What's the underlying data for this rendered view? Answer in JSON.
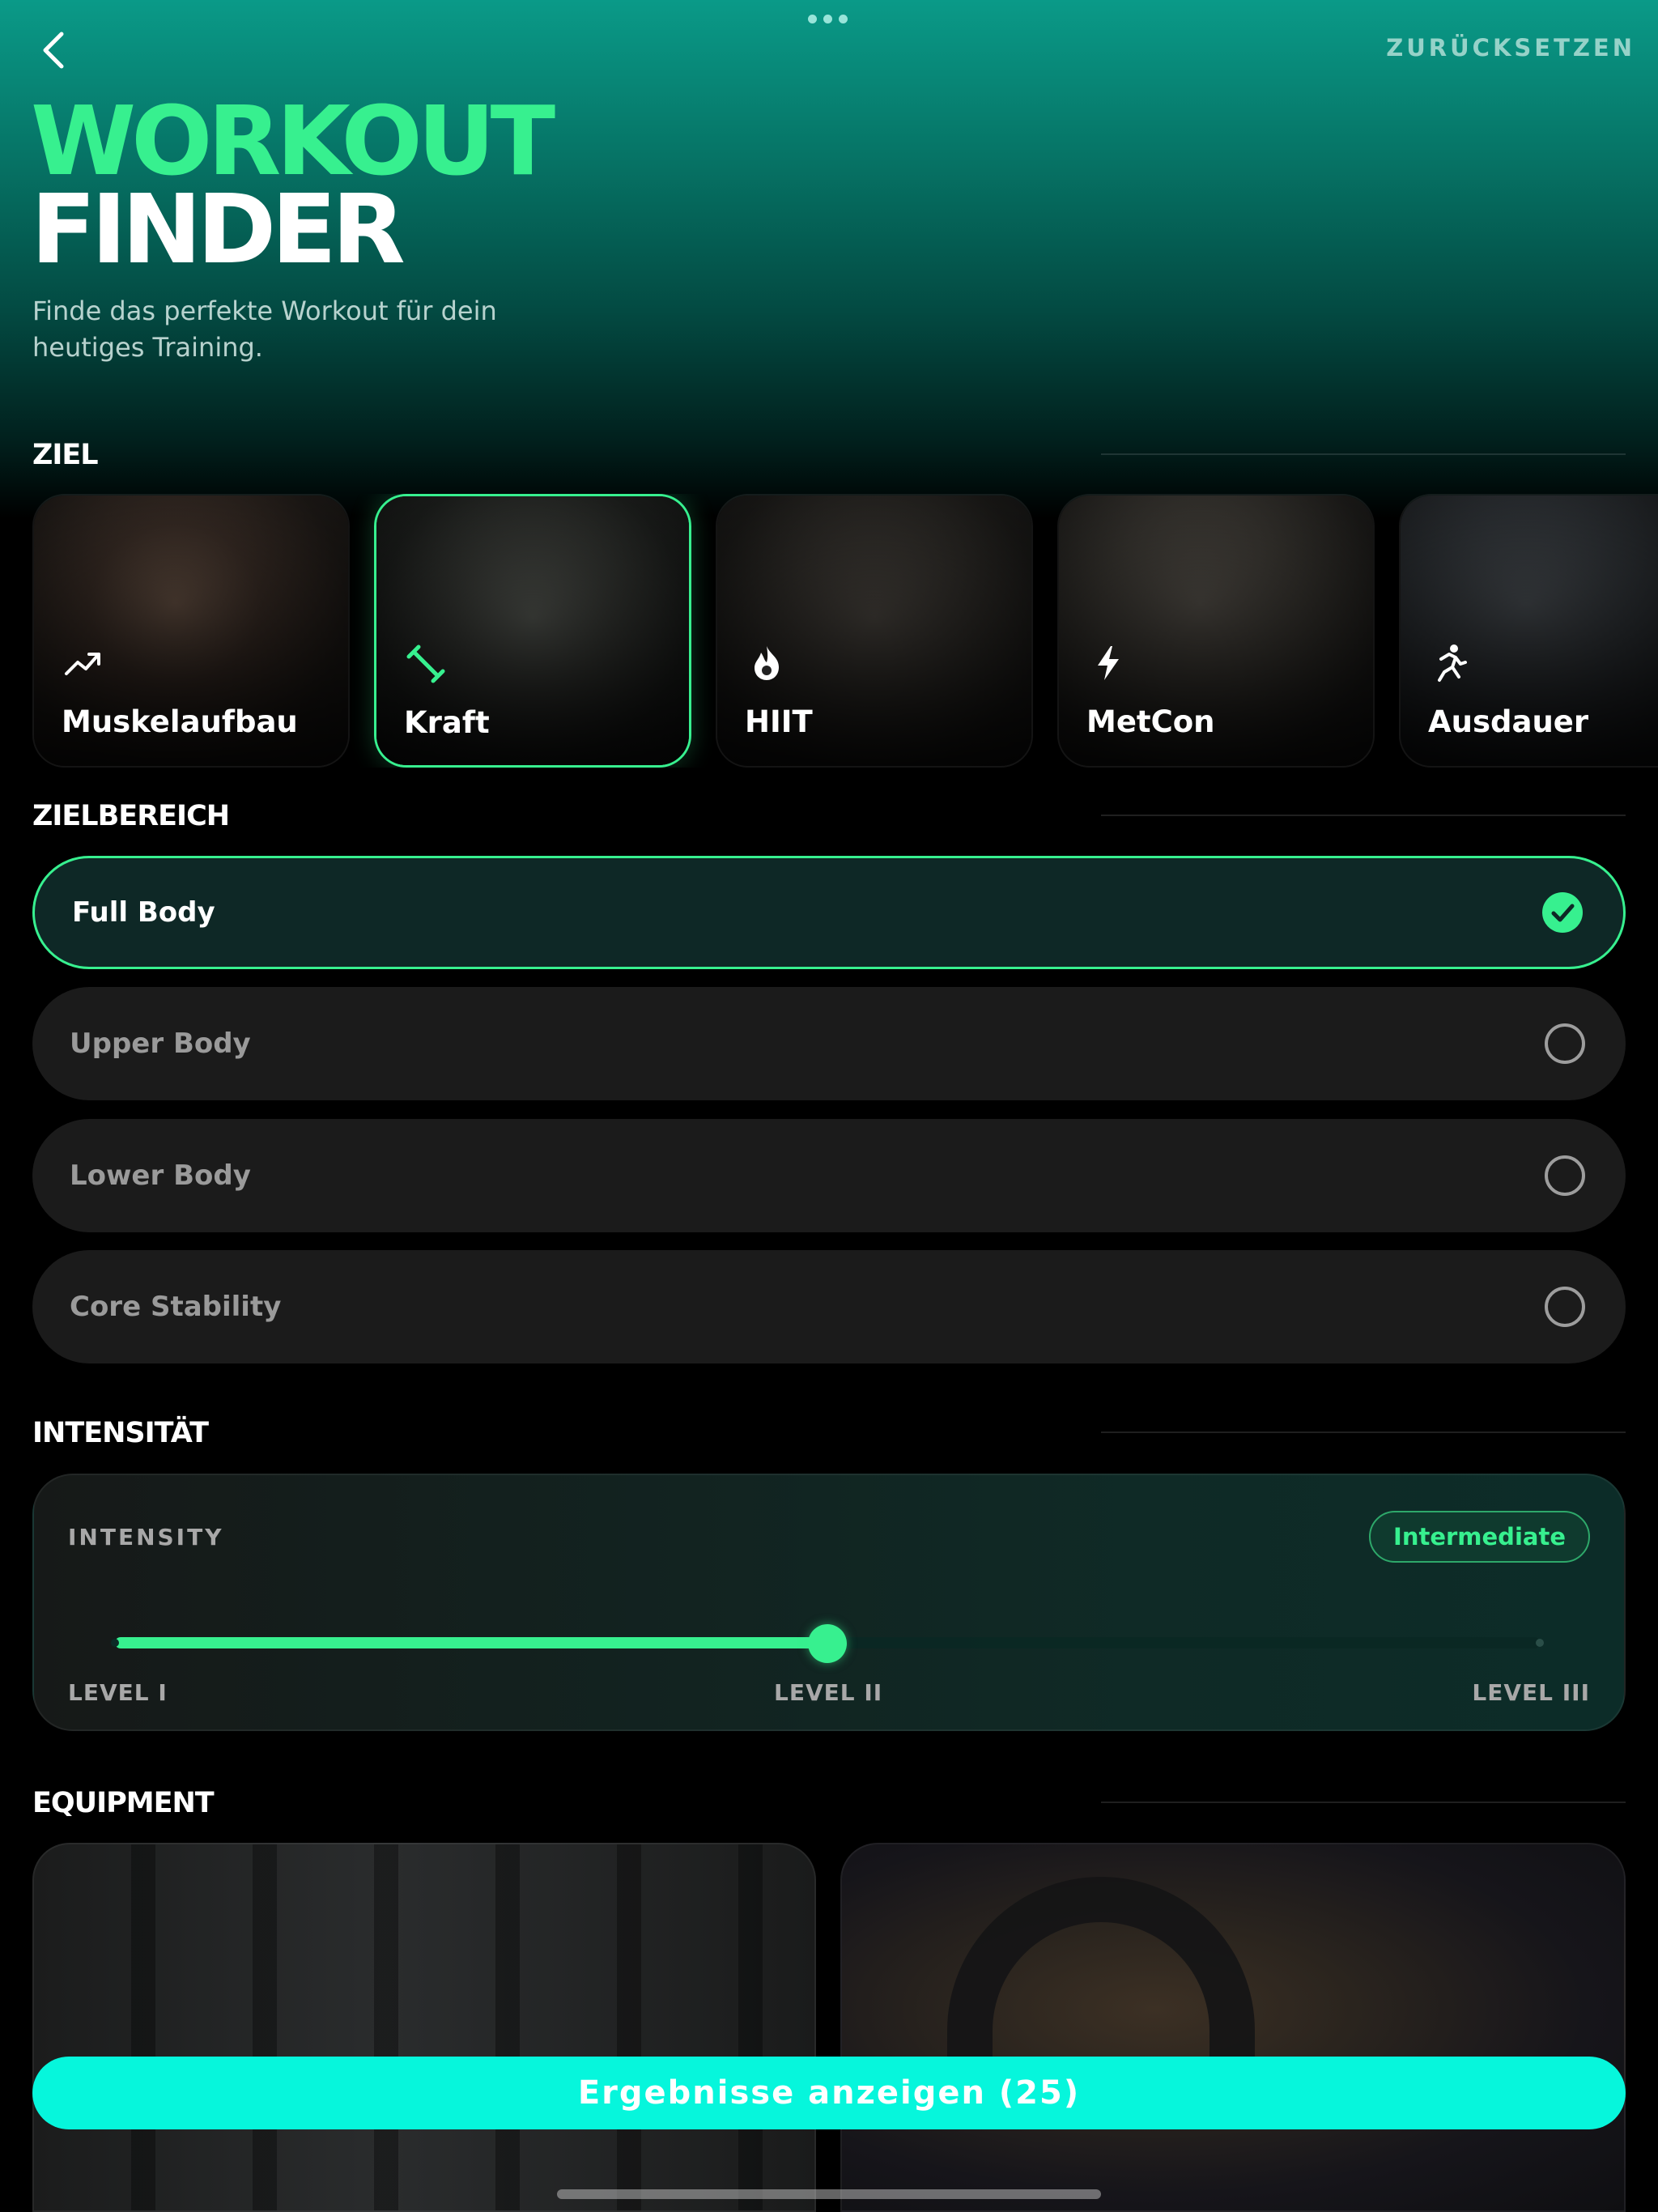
{
  "nav": {
    "reset_label": "ZURÜCKSETZEN"
  },
  "header": {
    "title_line1": "WORKOUT",
    "title_line2": "FINDER",
    "subtitle": "Finde das perfekte Workout für dein heutiges Training."
  },
  "goal": {
    "section_title": "ZIEL",
    "items": [
      {
        "label": "Muskelaufbau",
        "icon": "trending-up-icon",
        "selected": false
      },
      {
        "label": "Kraft",
        "icon": "dumbbell-icon",
        "selected": true
      },
      {
        "label": "HIIT",
        "icon": "flame-icon",
        "selected": false
      },
      {
        "label": "MetCon",
        "icon": "bolt-icon",
        "selected": false
      },
      {
        "label": "Ausdauer",
        "icon": "runner-icon",
        "selected": false
      }
    ]
  },
  "target_area": {
    "section_title": "ZIELBEREICH",
    "items": [
      {
        "label": "Full Body",
        "selected": true
      },
      {
        "label": "Upper Body",
        "selected": false
      },
      {
        "label": "Lower Body",
        "selected": false
      },
      {
        "label": "Core Stability",
        "selected": false
      }
    ]
  },
  "intensity": {
    "section_title": "INTENSITÄT",
    "card_label": "INTENSITY",
    "badge": "Intermediate",
    "value_fraction": 0.5,
    "levels": [
      "LEVEL I",
      "LEVEL II",
      "LEVEL III"
    ]
  },
  "equipment": {
    "section_title": "EQUIPMENT"
  },
  "cta": {
    "label": "Ergebnisse anzeigen (25)"
  },
  "colors": {
    "accent": "#37f08f",
    "cta": "#06f6dc",
    "header_teal": "#0a9a88"
  }
}
